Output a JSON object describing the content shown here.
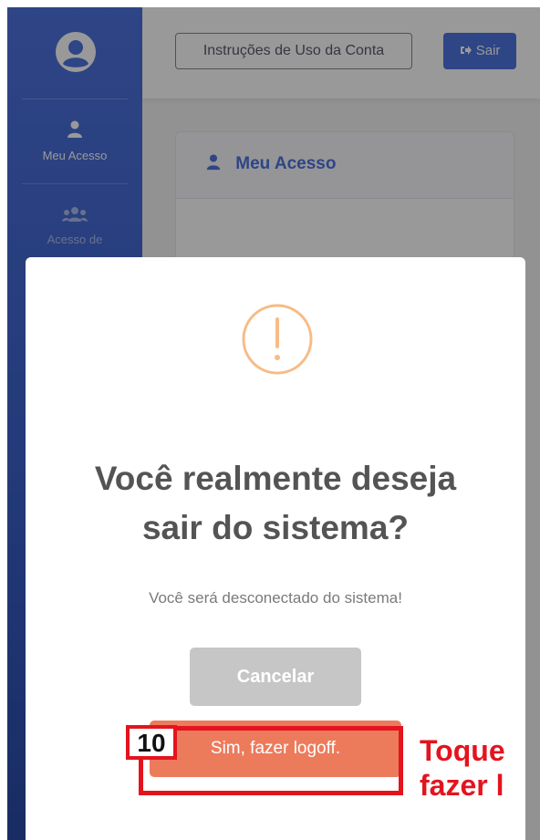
{
  "sidebar": {
    "items": [
      {
        "label": "Meu Acesso",
        "icon": "user-icon"
      },
      {
        "label": "Acesso de",
        "icon": "users-icon"
      }
    ]
  },
  "topbar": {
    "instructions_label": "Instruções de Uso da Conta",
    "logout_label": "Sair"
  },
  "card": {
    "title": "Meu Acesso"
  },
  "modal": {
    "title_line1": "Você realmente deseja",
    "title_line2": "sair do sistema?",
    "text": "Você será desconectado do sistema!",
    "cancel_label": "Cancelar",
    "confirm_label": "Sim, fazer logoff.",
    "icon": "warning-icon"
  },
  "annotation": {
    "step": "10",
    "callout": "Toque\nfazer l"
  },
  "colors": {
    "primary": "#4e73df",
    "confirm": "#ec7b5c",
    "cancel": "#c6c6c6",
    "warning": "#f8bb86",
    "annotation": "#e3141e"
  }
}
